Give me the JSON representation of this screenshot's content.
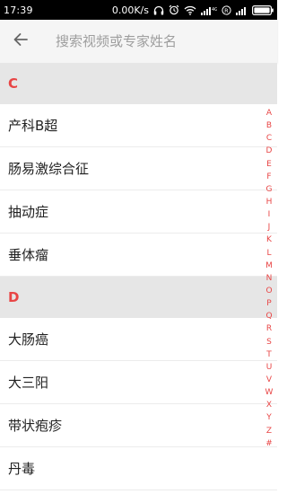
{
  "status_bar": {
    "time": "17:39",
    "network_speed": "0.00K/s",
    "icons": [
      "headphone-icon",
      "alarm-icon",
      "wifi-icon",
      "signal-4g-icon",
      "registered-icon",
      "signal-icon",
      "battery-icon"
    ]
  },
  "search": {
    "placeholder": "搜索视频或专家姓名",
    "value": ""
  },
  "sections": [
    {
      "letter": "C",
      "items": [
        "产科B超",
        "肠易激综合征",
        "抽动症",
        "垂体瘤"
      ]
    },
    {
      "letter": "D",
      "items": [
        "大肠癌",
        "大三阳",
        "带状疱疹",
        "丹毒"
      ]
    }
  ],
  "index_letters": [
    "A",
    "B",
    "C",
    "D",
    "E",
    "F",
    "G",
    "H",
    "I",
    "J",
    "K",
    "L",
    "M",
    "N",
    "O",
    "P",
    "Q",
    "R",
    "S",
    "T",
    "U",
    "V",
    "W",
    "X",
    "Y",
    "Z",
    "#"
  ],
  "colors": {
    "accent": "#e84545",
    "section_bg": "#e6e6e6",
    "search_bg": "#f5f5f5",
    "status_bg": "#000000"
  }
}
